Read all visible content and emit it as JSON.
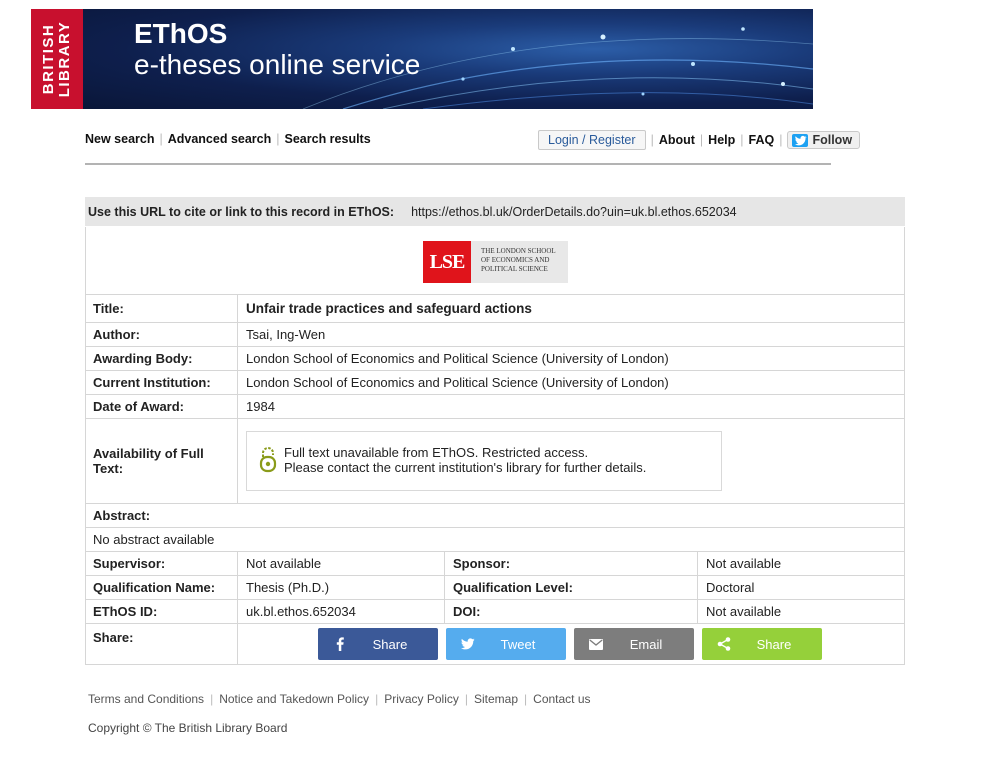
{
  "banner": {
    "logo_line1": "BRITISH",
    "logo_line2": "LIBRARY",
    "title": "EThOS",
    "subtitle": "e-theses online service"
  },
  "nav": {
    "new_search": "New search",
    "advanced_search": "Advanced search",
    "search_results": "Search results",
    "login": "Login / Register",
    "about": "About",
    "help": "Help",
    "faq": "FAQ",
    "follow": "Follow"
  },
  "cite": {
    "label": "Use this URL to cite or link to this record in EThOS:",
    "url": "https://ethos.bl.uk/OrderDetails.do?uin=uk.bl.ethos.652034"
  },
  "institution_logo": {
    "abbr": "LSE",
    "line1": "THE LONDON SCHOOL",
    "line2": "OF ECONOMICS AND",
    "line3": "POLITICAL SCIENCE",
    "color": "#e0141b"
  },
  "record": {
    "title_label": "Title:",
    "title": "Unfair trade practices and safeguard actions",
    "author_label": "Author:",
    "author": "Tsai, Ing-Wen",
    "awarding_label": "Awarding Body:",
    "awarding": "London School of Economics and Political Science (University of London)",
    "institution_label": "Current Institution:",
    "institution": "London School of Economics and Political Science (University of London)",
    "date_label": "Date of Award:",
    "date": "1984",
    "avail_label": "Availability of Full Text:",
    "avail_line1": "Full text unavailable from EThOS. Restricted access.",
    "avail_line2": "Please contact the current institution's library for further details.",
    "abstract_label": "Abstract:",
    "abstract": "No abstract available",
    "supervisor_label": "Supervisor:",
    "supervisor": "Not available",
    "sponsor_label": "Sponsor:",
    "sponsor": "Not available",
    "qual_name_label": "Qualification Name:",
    "qual_name": "Thesis (Ph.D.)",
    "qual_level_label": "Qualification Level:",
    "qual_level": "Doctoral",
    "ethos_id_label": "EThOS ID:",
    "ethos_id": "uk.bl.ethos.652034",
    "doi_label": "DOI:",
    "doi": "Not available",
    "share_label": "Share:"
  },
  "share_buttons": [
    {
      "label": "Share",
      "icon": "facebook-icon",
      "color": "#3b5998"
    },
    {
      "label": "Tweet",
      "icon": "twitter-icon",
      "color": "#55acee"
    },
    {
      "label": "Email",
      "icon": "email-icon",
      "color": "#7d7d7d"
    },
    {
      "label": "Share",
      "icon": "sharethis-icon",
      "color": "#95d03a"
    }
  ],
  "footer": {
    "terms": "Terms and Conditions",
    "notice": "Notice and Takedown Policy",
    "privacy": "Privacy Policy",
    "sitemap": "Sitemap",
    "contact": "Contact us",
    "copyright": "Copyright © The British Library Board"
  }
}
